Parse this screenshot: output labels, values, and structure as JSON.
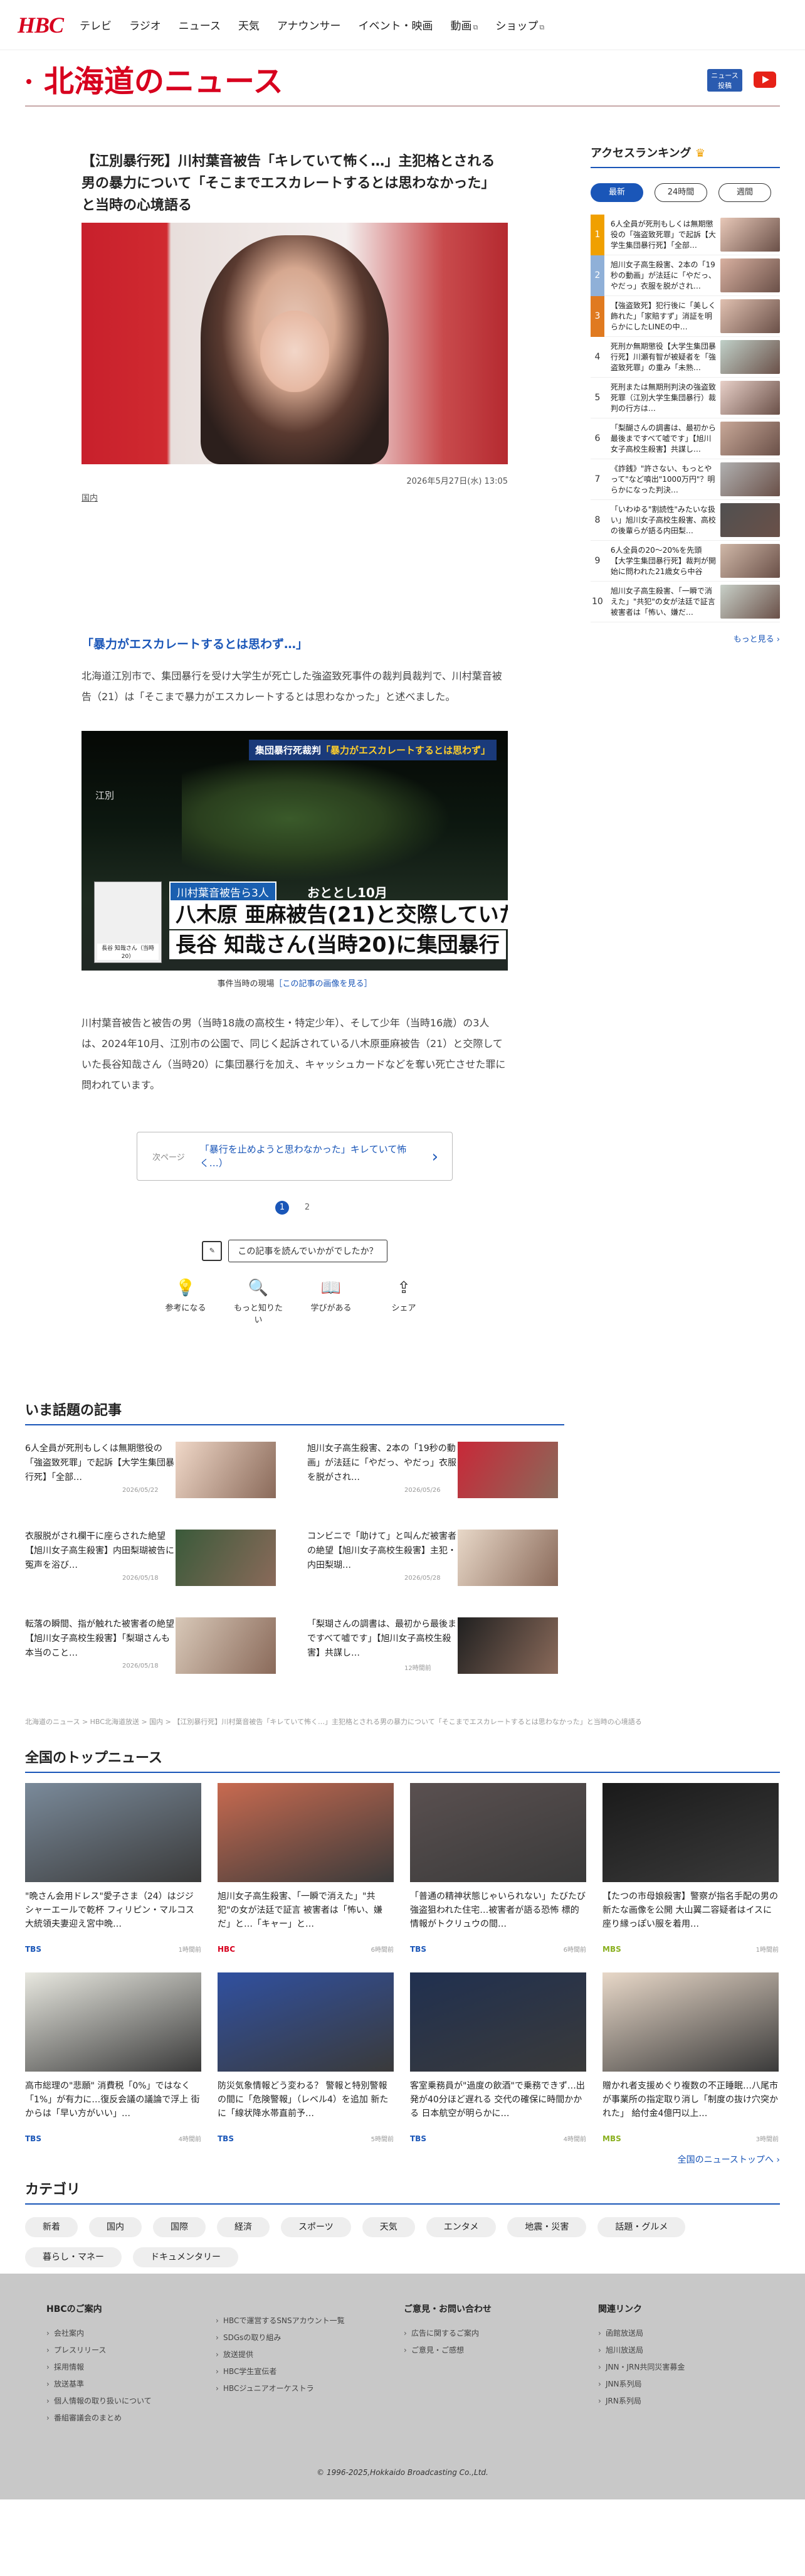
{
  "header": {
    "logo": "HBC",
    "nav": [
      {
        "label": "テレビ",
        "ext": false
      },
      {
        "label": "ラジオ",
        "ext": false
      },
      {
        "label": "ニュース",
        "ext": false
      },
      {
        "label": "天気",
        "ext": false
      },
      {
        "label": "アナウンサー",
        "ext": false
      },
      {
        "label": "イベント・映画",
        "ext": false
      },
      {
        "label": "動画",
        "ext": true
      },
      {
        "label": "ショップ",
        "ext": true
      }
    ]
  },
  "section": {
    "title": "北海道のニュース",
    "badge": "ニュース\n投稿"
  },
  "article": {
    "title": "【江別暴行死】川村葉音被告「キレていて怖く…」主犯格とされる男の暴力について「そこまでエスカレートするとは思わなかった」と当時の心境語る",
    "date": "2026年5月27日(水) 13:05",
    "category": "国内",
    "subheading": "「暴力がエスカレートするとは思わず…」",
    "p1": "北海道江別市で、集団暴行を受け大学生が死亡した強盗致死事件の裁判員裁判で、川村葉音被告（21）は「そこまで暴力がエスカレートするとは思わなかった」と述べました。",
    "photo2": {
      "tag_a": "集団暴行死裁判",
      "tag_b": "「暴力がエスカレートするとは思わず」",
      "location": "江別",
      "person": "長谷 知哉さん（当時20）",
      "line1a": "川村葉音被告ら3人",
      "line1b": "おととし10月",
      "line2": "八木原 亜麻被告(21)と交際していた",
      "line3": "長谷 知哉さん(当時20)に集団暴行"
    },
    "caption": "事件当時の現場",
    "caption_link": "［この記事の画像を見る］",
    "p2": "川村葉音被告と被告の男（当時18歳の高校生・特定少年）、そして少年（当時16歳）の3人は、2024年10月、江別市の公園で、同じく起訴されている八木原亜麻被告（21）と交際していた長谷知哉さん（当時20）に集団暴行を加え、キャッシュカードなどを奪い死亡させた罪に問われています。",
    "next_label": "次ページ",
    "next_text": "「暴行を止めようと思わなかった」キレていて怖く…）",
    "pages": [
      "1",
      "2"
    ],
    "feedback": "この記事を読んでいかがでしたか？",
    "reactions": [
      "参考になる",
      "もっと知りたい",
      "学びがある",
      "シェア"
    ]
  },
  "ranking": {
    "title": "アクセスランキング",
    "tabs": [
      "最新",
      "24時間",
      "週間"
    ],
    "items": [
      {
        "n": "1",
        "t": "6人全員が死刑もしくは無期懲役の「強盗致死罪」で起訴【大学生集団暴行死】「全部…"
      },
      {
        "n": "2",
        "t": "旭川女子高生殺害、2本の「19秒の動画」が法廷に「やだっ、やだっ」衣服を脱がされ…"
      },
      {
        "n": "3",
        "t": "【強盗致死】犯行後に「美しく飾れた」「家賠すず」消証を明らかにしたLINEの中…"
      },
      {
        "n": "4",
        "t": "死刑か無期懲役【大学生集団暴行死】川瀬有智が被疑者を「強盗致死罪」の重み「未熟…"
      },
      {
        "n": "5",
        "t": "死刑または無期刑判決の強盗致死罪（江別大学生集団暴行）裁判の行方は…"
      },
      {
        "n": "6",
        "t": "「梨醐さんの調書は、最初から最後まですべて嘘です」【旭川女子高校生殺害】共謀し…"
      },
      {
        "n": "7",
        "t": "《詐銭》\"許さない、もっとやって\"など噴出\"1000万円\"？明らかになった判決…"
      },
      {
        "n": "8",
        "t": "「いわゆる\"割読性\"みたいな扱い」旭川女子高校生殺害、高校の後輩らが語る内田梨…"
      },
      {
        "n": "9",
        "t": "6人全員の20〜20%を先頭【大学生集団暴行死】裁判が開始に問われた21歳女ら中谷被…"
      },
      {
        "n": "10",
        "t": "旭川女子高生殺害、「一瞬で消えた」\"共犯\"の女が法廷で証言 被害者は「怖い、嫌だ…"
      }
    ],
    "more": "もっと見る"
  },
  "topics": {
    "title": "いま話題の記事",
    "items": [
      {
        "t": "6人全員が死刑もしくは無期懲役の「強盗致死罪」で起訴【大学生集団暴行死】「全部…",
        "d": "2026/05/22"
      },
      {
        "t": "旭川女子高生殺害、2本の「19秒の動画」が法廷に「やだっ、やだっ」衣服を脱がされ…",
        "d": "2026/05/26"
      },
      {
        "t": "衣服脱がされ欄干に座らされた絶望【旭川女子高生殺害】内田梨瑚被告に冤声を浴び…",
        "d": "2026/05/18"
      },
      {
        "t": "コンビニで「助けて」と叫んだ被害者の絶望【旭川女子高校生殺害】主犯・内田梨瑚…",
        "d": "2026/05/28"
      },
      {
        "t": "転落の瞬間、指が触れた被害者の絶望【旭川女子高校生殺害】「梨瑚さんも本当のこと…",
        "d": "2026/05/18"
      },
      {
        "t": "「梨瑚さんの調書は、最初から最後まですべて嘘です」【旭川女子高校生殺害】共謀し…",
        "d": "12時間前"
      }
    ]
  },
  "breadcrumb": "北海道のニュース > HBC北海道放送 > 国内 > 【江別暴行死】川村葉音被告「キレていて怖く…」主犯格とされる男の暴力について「そこまでエスカレートするとは思わなかった」と当時の心境語る",
  "national": {
    "title": "全国のトップニュース",
    "items": [
      {
        "t": "\"晩さん会用ドレス\"愛子さま（24）はジジシャーエールで乾杯 フィリピン・マルコス大統領夫妻迎え宮中晩…",
        "s": "TBS",
        "d": "1時間前",
        "c": "#7a8a9a"
      },
      {
        "t": "旭川女子高生殺害、「一瞬で消えた」\"共犯\"の女が法廷で証言 被害者は「怖い、嫌だ」と…「キャー」と…",
        "s": "HBC",
        "d": "6時間前",
        "c": "#c86a50"
      },
      {
        "t": "「普通の精神状態じゃいられない」たびたび強盗狙われた住宅…被害者が語る恐怖 標的情報がトクリュウの間…",
        "s": "TBS",
        "d": "6時間前",
        "c": "#5a5050"
      },
      {
        "t": "【たつの市母娘殺害】警察が指名手配の男の新たな画像を公開 大山翼二容疑者はイスに座り縁っぽい服を着用…",
        "s": "MBS",
        "d": "1時間前",
        "c": "#1a1a1a"
      },
      {
        "t": "高市総理の\"悲願\" 消費税「0%」ではなく「1%」が有力に…復反会議の議論で浮上 街からは「早い方がいい」…",
        "s": "TBS",
        "d": "4時間前",
        "c": "#e8e8e0"
      },
      {
        "t": "防災気象情報どう変わる？ 警報と特別警報の間に「危険警報」（レベル4）を追加 新たに「線状降水帯直前予…",
        "s": "TBS",
        "d": "5時間前",
        "c": "#3050a0"
      },
      {
        "t": "客室乗務員が\"過度の飲酒\"で乗務できず…出発が40分ほど遅れる 交代の確保に時間かかる 日本航空が明らかに…",
        "s": "TBS",
        "d": "4時間前",
        "c": "#203050"
      },
      {
        "t": "贈かれ者支援めぐり複数の不正睡眠…八尾市が事業所の指定取り消し「制度の抜け穴突かれた」 給付金4億円以上…",
        "s": "MBS",
        "d": "3時間前",
        "c": "#e8d8c8"
      }
    ],
    "more": "全国のニューストップへ"
  },
  "categories": {
    "title": "カテゴリ",
    "items": [
      "新着",
      "国内",
      "国際",
      "経済",
      "スポーツ",
      "天気",
      "エンタメ",
      "地震・災害",
      "話題・グルメ",
      "暮らし・マネー",
      "ドキュメンタリー"
    ]
  },
  "footer": {
    "cols": [
      {
        "h": "HBCのご案内",
        "items": [
          "会社案内",
          "プレスリリース",
          "採用情報",
          "放送基準",
          "個人情報の取り扱いについて",
          "番組審議会のまとめ"
        ]
      },
      {
        "h": "",
        "items": [
          "HBCで運営するSNSアカウント一覧",
          "SDGsの取り組み",
          "放送提供",
          "HBC学生宣伝者",
          "HBCジュニアオーケストラ"
        ]
      },
      {
        "h": "ご意見・お問い合わせ",
        "items": [
          "広告に関するご案内",
          "ご意見・ご感想"
        ]
      },
      {
        "h": "関連リンク",
        "items": [
          "函館放送局",
          "旭川放送局",
          "JNN・JRN共同災害募金",
          "JNN系列局",
          "JRN系列局"
        ]
      }
    ],
    "copyright": "© 1996-2025,Hokkaido Broadcasting Co.,Ltd."
  },
  "colors": {
    "brand": "#d7001e",
    "accent": "#1a56b8"
  }
}
